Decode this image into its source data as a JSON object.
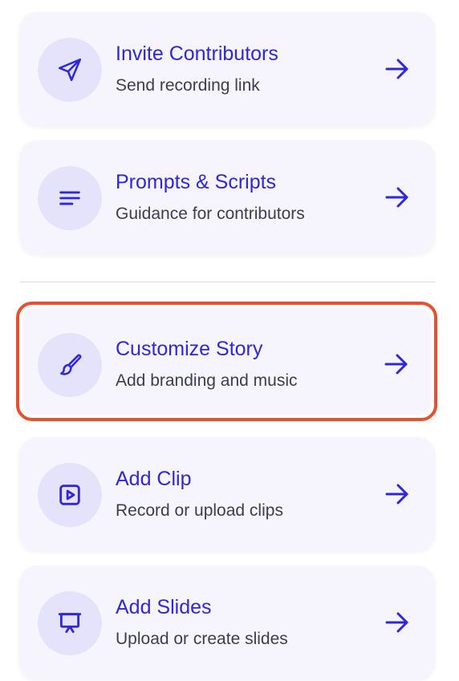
{
  "colors": {
    "accent": "#2f27d9",
    "card_bg": "#f6f5fe",
    "icon_bg": "#e5e3fb",
    "highlight_border": "#e5502e",
    "subtitle": "#3d3d4d"
  },
  "cards": [
    {
      "icon": "send-icon",
      "title": "Invite Contributors",
      "subtitle": "Send recording link",
      "arrow_icon": "arrow-right-icon"
    },
    {
      "icon": "lines-icon",
      "title": "Prompts & Scripts",
      "subtitle": "Guidance for contributors",
      "arrow_icon": "arrow-right-icon"
    },
    {
      "icon": "brush-icon",
      "title": "Customize Story",
      "subtitle": "Add branding and music",
      "arrow_icon": "arrow-right-icon",
      "highlighted": true
    },
    {
      "icon": "play-square-icon",
      "title": "Add Clip",
      "subtitle": "Record or upload clips",
      "arrow_icon": "arrow-right-icon"
    },
    {
      "icon": "presentation-icon",
      "title": "Add Slides",
      "subtitle": "Upload or create slides",
      "arrow_icon": "arrow-right-icon"
    }
  ]
}
